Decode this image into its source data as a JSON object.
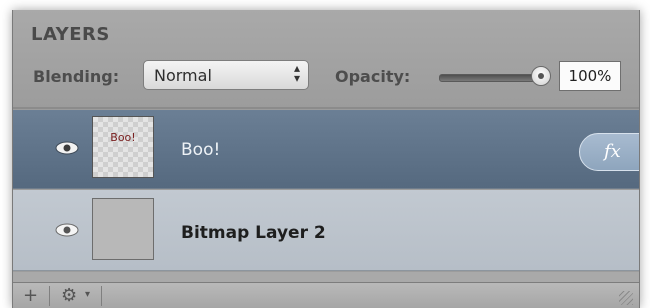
{
  "panel": {
    "title": "LAYERS",
    "blending_label": "Blending:",
    "blending_value": "Normal",
    "opacity_label": "Opacity:",
    "opacity_value": "100%",
    "opacity_level": 1.0
  },
  "layers": [
    {
      "name": "Boo!",
      "thumb_text": "Boo!",
      "selected": true,
      "has_fx": true,
      "fx_label": "fx"
    },
    {
      "name": "Bitmap Layer 2",
      "selected": false,
      "has_fx": false
    }
  ],
  "footer": {
    "add_label": "+",
    "gear_symbol": "⚙",
    "gear_caret": "▾"
  },
  "icons": [
    "eye-icon",
    "gear-icon",
    "plus-icon",
    "fx-icon"
  ],
  "colors": {
    "selected_row": "#5f7389",
    "normal_row": "#bcc3cb",
    "panel_bg": "#a3a3a3"
  }
}
